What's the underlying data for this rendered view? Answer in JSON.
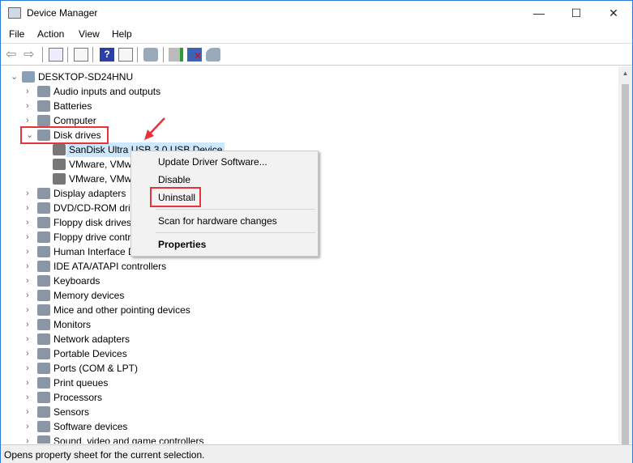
{
  "window": {
    "title": "Device Manager",
    "minimize": "—",
    "maximize": "☐",
    "close": "✕"
  },
  "menu": [
    "File",
    "Action",
    "View",
    "Help"
  ],
  "toolbar": [
    "back-icon",
    "forward-icon",
    "show-hide-console-tree-icon",
    "properties-icon",
    "help-icon",
    "action-pane-icon",
    "scan-hardware-icon",
    "update-driver-icon",
    "uninstall-icon",
    "disable-icon"
  ],
  "tree": {
    "root": "DESKTOP-SD24HNU",
    "items": [
      {
        "label": "Audio inputs and outputs",
        "expanded": false
      },
      {
        "label": "Batteries",
        "expanded": false
      },
      {
        "label": "Computer",
        "expanded": false
      },
      {
        "label": "Disk drives",
        "expanded": true,
        "children": [
          "SanDisk Ultra USB 3.0 USB Device",
          "VMware, VMware Virtual S SCSI Disk Device",
          "VMware, VMware Virtual S SCSI Disk Device"
        ]
      },
      {
        "label": "Display adapters"
      },
      {
        "label": "DVD/CD-ROM drives"
      },
      {
        "label": "Floppy disk drives"
      },
      {
        "label": "Floppy drive controllers"
      },
      {
        "label": "Human Interface Devices"
      },
      {
        "label": "IDE ATA/ATAPI controllers"
      },
      {
        "label": "Keyboards"
      },
      {
        "label": "Memory devices"
      },
      {
        "label": "Mice and other pointing devices"
      },
      {
        "label": "Monitors"
      },
      {
        "label": "Network adapters"
      },
      {
        "label": "Portable Devices"
      },
      {
        "label": "Ports (COM & LPT)"
      },
      {
        "label": "Print queues"
      },
      {
        "label": "Processors"
      },
      {
        "label": "Sensors"
      },
      {
        "label": "Software devices"
      },
      {
        "label": "Sound, video and game controllers"
      }
    ]
  },
  "context_menu": {
    "update": "Update Driver Software...",
    "disable": "Disable",
    "uninstall": "Uninstall",
    "scan": "Scan for hardware changes",
    "properties": "Properties"
  },
  "status": "Opens property sheet for the current selection.",
  "colors": {
    "highlight": "#e8323c",
    "selection": "#cce8ff"
  }
}
